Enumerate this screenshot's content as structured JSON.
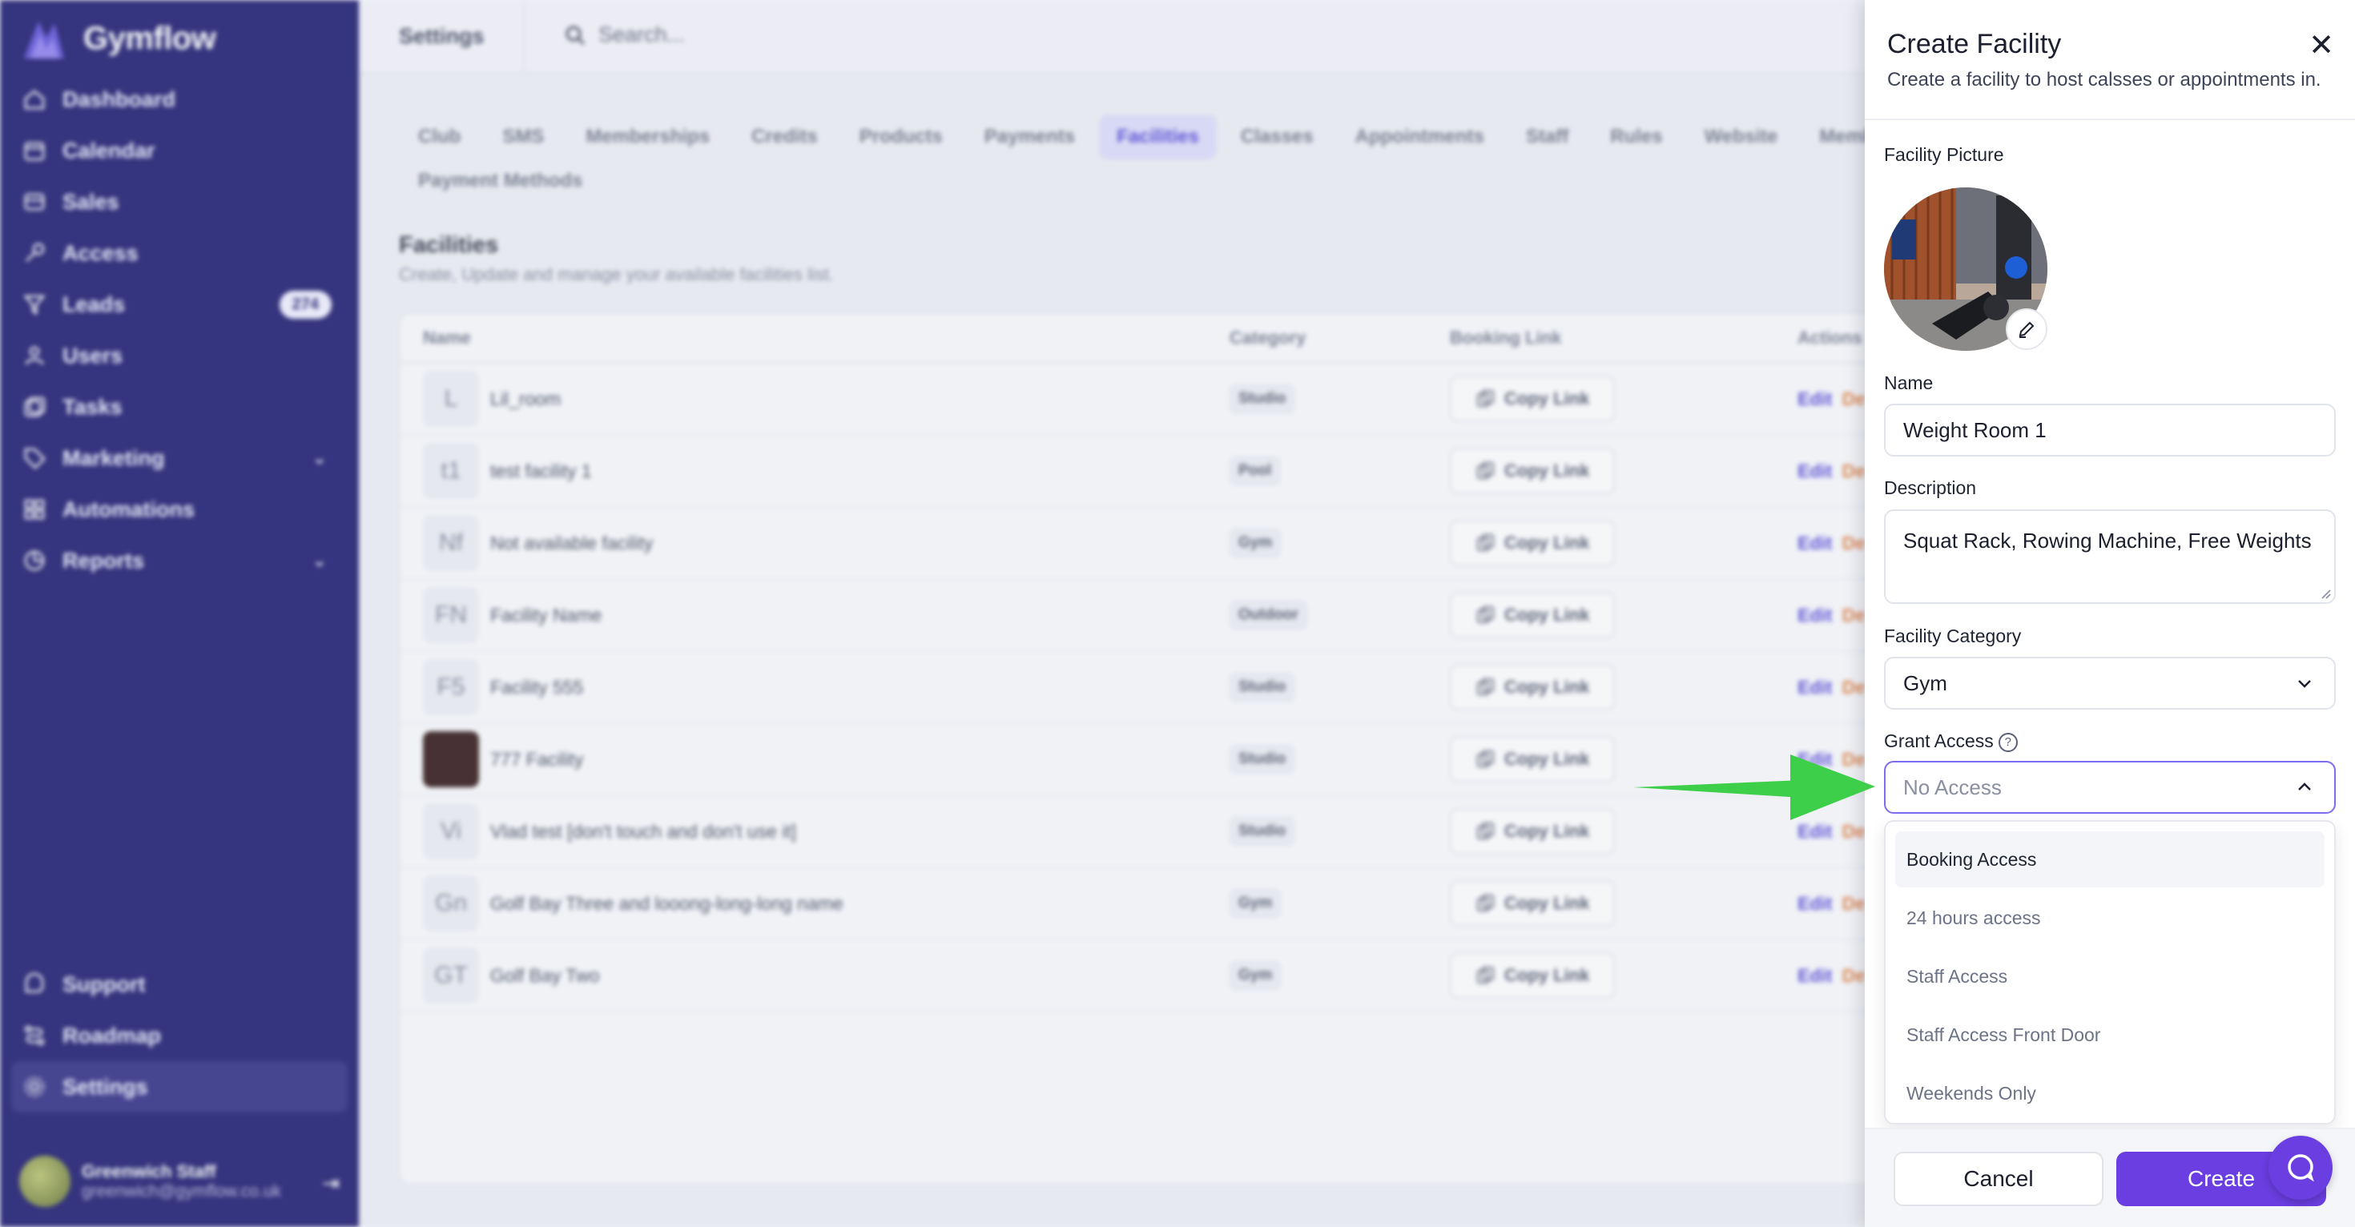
{
  "brand": {
    "name": "Gymflow"
  },
  "sidebar": {
    "items": [
      {
        "label": "Dashboard",
        "icon": "home-icon"
      },
      {
        "label": "Calendar",
        "icon": "calendar-icon"
      },
      {
        "label": "Sales",
        "icon": "sales-icon"
      },
      {
        "label": "Access",
        "icon": "key-icon"
      },
      {
        "label": "Leads",
        "icon": "filter-icon",
        "badge": "274"
      },
      {
        "label": "Users",
        "icon": "users-icon"
      },
      {
        "label": "Tasks",
        "icon": "tasks-icon"
      },
      {
        "label": "Marketing",
        "icon": "tag-icon"
      },
      {
        "label": "Automations",
        "icon": "automations-icon"
      },
      {
        "label": "Reports",
        "icon": "reports-icon"
      }
    ],
    "bottom_items": [
      {
        "label": "Support",
        "icon": "support-icon"
      },
      {
        "label": "Roadmap",
        "icon": "roadmap-icon"
      },
      {
        "label": "Settings",
        "icon": "gear-icon"
      }
    ],
    "user": {
      "name": "Greenwich Staff",
      "email": "greenwich@gymflow.co.uk"
    }
  },
  "topbar": {
    "title": "Settings",
    "search_placeholder": "Search..."
  },
  "tabs": {
    "row1": [
      "Club",
      "SMS",
      "Memberships",
      "Credits",
      "Products",
      "Payments",
      "Facilities",
      "Classes",
      "Appointments",
      "Staff",
      "Rules",
      "Website",
      "Members Ap"
    ],
    "row2": [
      "Payment Methods"
    ],
    "active": "Facilities"
  },
  "section": {
    "title": "Facilities",
    "subtitle": "Create, Update and manage your available facilities list."
  },
  "table": {
    "headers": {
      "name": "Name",
      "category": "Category",
      "link": "Booking Link",
      "actions": "Actions"
    },
    "copy_label": "Copy Link",
    "edit_label": "Edit",
    "delete_label": "De",
    "rows": [
      {
        "initials": "L",
        "name": "Lil_room",
        "category": "Studio"
      },
      {
        "initials": "t1",
        "name": "test facility 1",
        "category": "Pool"
      },
      {
        "initials": "Nf",
        "name": "Not available facility",
        "category": "Gym"
      },
      {
        "initials": "FN",
        "name": "Facility Name",
        "category": "Outdoor"
      },
      {
        "initials": "F5",
        "name": "Facility 555",
        "category": "Studio"
      },
      {
        "initials": "",
        "name": "777 Facility",
        "category": "Studio"
      },
      {
        "initials": "Vi",
        "name": "Vlad test [don't touch and don't use it]",
        "category": "Studio"
      },
      {
        "initials": "Gn",
        "name": "Golf Bay Three and looong-long-long name",
        "category": "Gym"
      },
      {
        "initials": "GT",
        "name": "Golf Bay Two",
        "category": "Gym"
      }
    ]
  },
  "drawer": {
    "title": "Create Facility",
    "subtitle": "Create a facility to host calsses or appointments in.",
    "picture_label": "Facility Picture",
    "name_label": "Name",
    "name_value": "Weight Room 1",
    "description_label": "Description",
    "description_value": "Squat Rack, Rowing Machine, Free Weights",
    "category_label": "Facility Category",
    "category_value": "Gym",
    "access_label": "Grant Access",
    "access_placeholder": "No Access",
    "access_options": [
      "Booking Access",
      "24 hours access",
      "Staff Access",
      "Staff Access Front Door",
      "Weekends Only"
    ],
    "cancel_label": "Cancel",
    "create_label": "Create"
  },
  "colors": {
    "sidebar_bg": "#15136b",
    "accent": "#6a3ee0",
    "arrow": "#3ecf4a"
  }
}
